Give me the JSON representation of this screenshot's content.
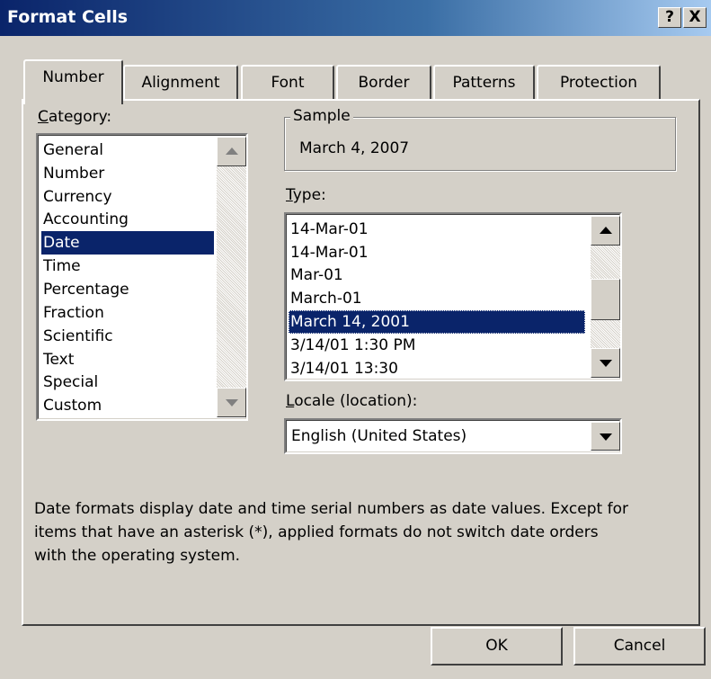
{
  "window": {
    "title": "Format Cells",
    "help_button": "?",
    "close_button": "X"
  },
  "tabs": [
    {
      "label": "Number",
      "active": true
    },
    {
      "label": "Alignment",
      "active": false
    },
    {
      "label": "Font",
      "active": false
    },
    {
      "label": "Border",
      "active": false
    },
    {
      "label": "Patterns",
      "active": false
    },
    {
      "label": "Protection",
      "active": false
    }
  ],
  "category": {
    "label_hotkey": "C",
    "label_rest": "ategory:",
    "items": [
      "General",
      "Number",
      "Currency",
      "Accounting",
      "Date",
      "Time",
      "Percentage",
      "Fraction",
      "Scientific",
      "Text",
      "Special",
      "Custom"
    ],
    "selected": "Date"
  },
  "sample": {
    "label": "Sample",
    "value": "March 4, 2007"
  },
  "type": {
    "label_hotkey": "T",
    "label_rest": "ype:",
    "items": [
      "14-Mar-01",
      "14-Mar-01",
      "Mar-01",
      "March-01",
      "March 14, 2001",
      "3/14/01 1:30 PM",
      "3/14/01 13:30"
    ],
    "selected": "March 14, 2001"
  },
  "locale": {
    "label_hotkey": "L",
    "label_rest": "ocale (location):",
    "value": "English (United States)"
  },
  "description": {
    "line1": "Date formats display date and time serial numbers as date values.  Except for",
    "line2": "items that have an asterisk (*), applied formats do not switch date orders",
    "line3": "with the operating system."
  },
  "buttons": {
    "ok": "OK",
    "cancel": "Cancel"
  },
  "icons": {
    "scroll_up": "scroll-up-arrow-icon",
    "scroll_down": "scroll-down-arrow-icon",
    "dropdown": "dropdown-arrow-icon"
  }
}
